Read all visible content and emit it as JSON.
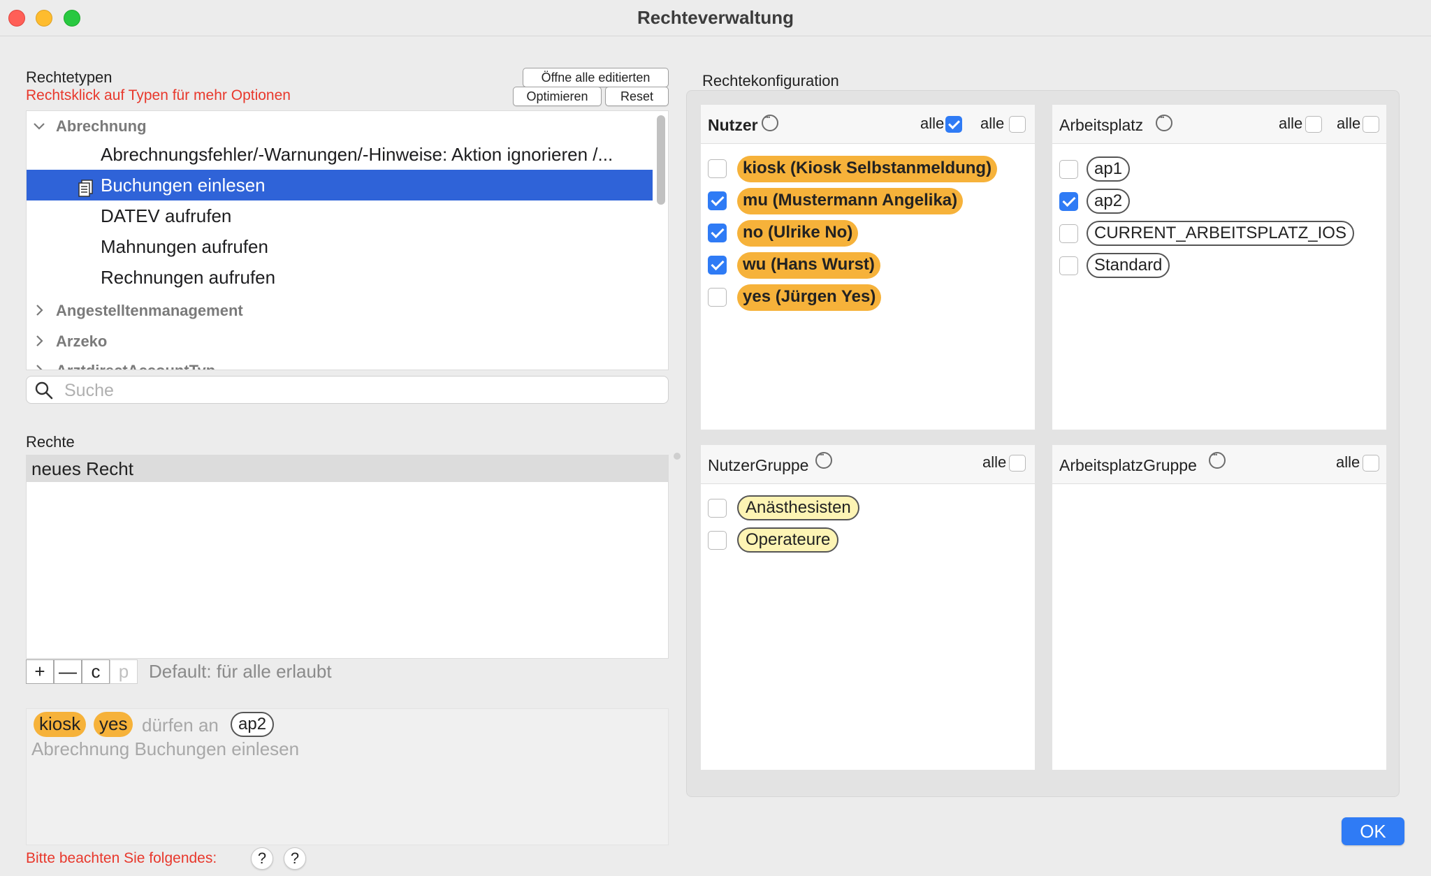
{
  "window": {
    "title": "Rechteverwaltung"
  },
  "left": {
    "rechtetypen_label": "Rechtetypen",
    "hint": "Rechtsklick auf Typen für mehr Optionen",
    "buttons": {
      "open_all": "Öffne alle editierten",
      "optimize": "Optimieren",
      "reset": "Reset"
    },
    "tree": [
      {
        "label": "Abrechnung",
        "type": "group",
        "expanded": true
      },
      {
        "label": "Abrechnungsfehler/-Warnungen/-Hinweise: Aktion ignorieren /...",
        "type": "item"
      },
      {
        "label": "Buchungen einlesen",
        "type": "item",
        "selected": true,
        "icon": "document-icon"
      },
      {
        "label": "DATEV aufrufen",
        "type": "item"
      },
      {
        "label": "Mahnungen aufrufen",
        "type": "item"
      },
      {
        "label": "Rechnungen aufrufen",
        "type": "item"
      },
      {
        "label": "Angestelltenmanagement",
        "type": "group",
        "expanded": false
      },
      {
        "label": "Arzeko",
        "type": "group",
        "expanded": false
      },
      {
        "label": "ArztdirectAccountTyp",
        "type": "group",
        "expanded": false
      }
    ],
    "search_placeholder": "Suche",
    "rechte_label": "Rechte",
    "rechte": [
      "neues Recht"
    ],
    "toolbar": {
      "add": "+",
      "remove": "—",
      "c": "c",
      "p": "p"
    },
    "default_text": "Default: für alle erlaubt",
    "summary": {
      "users": [
        "kiosk",
        "yes"
      ],
      "middle": "dürfen an",
      "workplace": "ap2",
      "description": "Abrechnung Buchungen einlesen"
    },
    "notice": "Bitte beachten Sie folgendes:",
    "help": [
      "?",
      "?"
    ]
  },
  "config": {
    "label": "Rechtekonfiguration",
    "nutzer": {
      "title": "Nutzer",
      "alle": [
        "alle",
        "alle"
      ],
      "alle_checked": [
        true,
        false
      ],
      "items": [
        {
          "label": "kiosk (Kiosk Selbstanmeldung)",
          "checked": false
        },
        {
          "label": "mu (Mustermann Angelika)",
          "checked": true
        },
        {
          "label": "no (Ulrike No)",
          "checked": true
        },
        {
          "label": "wu (Hans Wurst)",
          "checked": true
        },
        {
          "label": "yes (Jürgen Yes)",
          "checked": false
        }
      ]
    },
    "arbeitsplatz": {
      "title": "Arbeitsplatz",
      "alle": [
        "alle",
        "alle"
      ],
      "alle_checked": [
        false,
        false
      ],
      "items": [
        {
          "label": "ap1",
          "checked": false
        },
        {
          "label": "ap2",
          "checked": true
        },
        {
          "label": "CURRENT_ARBEITSPLATZ_IOS",
          "checked": false
        },
        {
          "label": "Standard",
          "checked": false
        }
      ]
    },
    "nutzergruppe": {
      "title": "NutzerGruppe",
      "alle": "alle",
      "items": [
        {
          "label": "Anästhesisten",
          "checked": false
        },
        {
          "label": "Operateure",
          "checked": false
        }
      ]
    },
    "arbeitsplatzgruppe": {
      "title": "ArbeitsplatzGruppe",
      "alle": "alle",
      "items": []
    }
  },
  "ok": "OK",
  "colors": {
    "accent": "#2f7bf5",
    "selection": "#2f63d8",
    "user_chip": "#f6b23a",
    "group_chip": "#fdf4b4",
    "hint": "#e8382c"
  }
}
